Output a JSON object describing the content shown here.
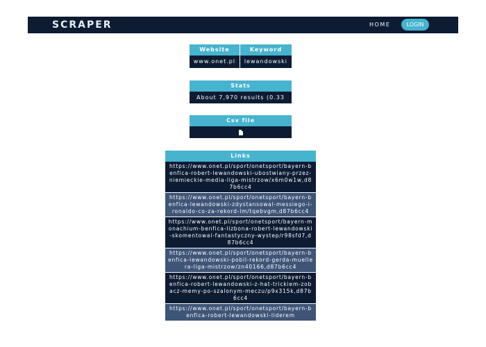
{
  "nav": {
    "logo": "SCRAPER",
    "home": "HOME",
    "login": "LOGIN"
  },
  "search_table": {
    "headers": [
      "Website",
      "Keyword"
    ],
    "website": "www.onet.pl",
    "keyword": "lewandowski"
  },
  "stats_table": {
    "header": "Stats",
    "value": "About 7,970 results (0.33"
  },
  "csv_table": {
    "header": "Csv file",
    "icon": "file-download-icon"
  },
  "links_table": {
    "header": "Links",
    "rows": [
      "https://www.onet.pl/sport/onetsport/bayern-benfica-robert-lewandowski-ubostwiany-przez-niemieckie-media-liga-mistrzow/x6m0w1w,d87b6cc4",
      "https://www.onet.pl/sport/onetsport/bayern-benfica-lewandowski-zdystansowal-messiego-i-ronaldo-co-za-rekord-lm/tqebvgm,d87b6cc4",
      "https://www.onet.pl/sport/onetsport/bayern-monachium-benfica-lizbona-robert-lewandowski-skomentowal-fantastyczny-wystep/r98sfd7,d87b6cc4",
      "https://www.onet.pl/sport/onetsport/bayern-benfica-lewandowski-pobil-rekord-gerda-muellera-liga-mistrzow/zn40166,d87b6cc4",
      "https://www.onet.pl/sport/onetsport/bayern-benfica-robert-lewandowski-z-hat-trickiem-zobacz-memy-po-szalonym-meczu/p9x315k,d87b6cc4",
      "https://www.onet.pl/sport/onetsport/bayern-benfica-robert-lewandowski-liderem"
    ]
  },
  "colors": {
    "navy": "#0d1b33",
    "accent": "#46b3cf",
    "alt_row": "#3e5577"
  }
}
